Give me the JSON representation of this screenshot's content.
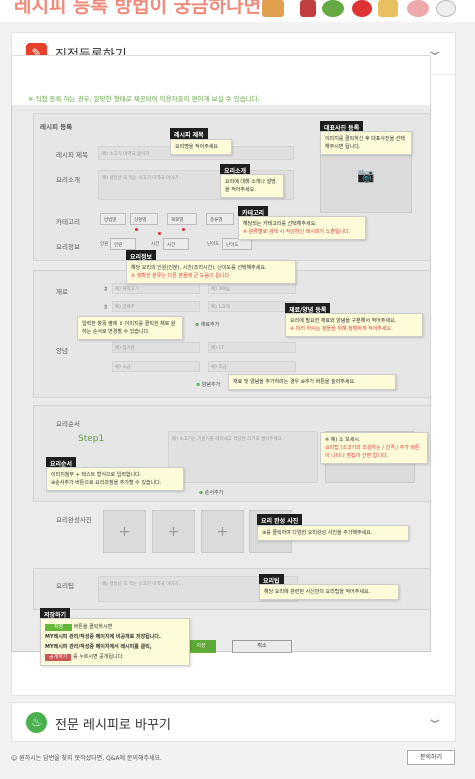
{
  "top": {
    "title": "레시피 등록 방법이 궁금하다면?"
  },
  "card": {
    "title": "직접등록하기"
  },
  "notice": "※ 직접 등록 하는 경우, 알맞한 형태로 제공되어 이용자들이 편하게 보실 수 있습니다.",
  "register": {
    "section_label": "레시피 등록",
    "title_label": "레시피 제목",
    "title_placeholder": "예) 소고기 미역국 끓이기",
    "intro_label": "요리소개",
    "intro_placeholder": "예) 생일날 꼭 먹는 소고기 미역국 이야기...",
    "category_label": "카테고리",
    "category_options": [
      "방법별",
      "상황별",
      "재료별",
      "종류별"
    ],
    "info_label": "요리정보",
    "info_items": [
      "인원",
      "인원",
      "시간",
      "시간",
      "난이도",
      "난이도"
    ],
    "photo_placeholder": "",
    "photo_label": ""
  },
  "ingredients": {
    "label": "재료",
    "rows": [
      [
        "예) 돼지고기",
        "예) 300g"
      ],
      [
        "예) 양배추",
        "예) 1/2개"
      ]
    ],
    "add": "재료추가"
  },
  "seasoning": {
    "label": "양념",
    "rows": [
      [
        "예) 참기름",
        "예) 1T"
      ],
      [
        "예) 소금",
        "예) 조금"
      ]
    ],
    "add": "양념추가"
  },
  "steps": {
    "label": "요리순서",
    "step": "Step1",
    "placeholder": "예) 소고기는 기름기를 떼어내고 적당한 크기로 썰어주세요.",
    "add": "순서추가"
  },
  "complete": {
    "label": "요리완성사진"
  },
  "tip": {
    "label": "요리팁",
    "placeholder": "예) 생일날 꼭 먹는 소고기 미역국 이야기..."
  },
  "buttons": {
    "save": "저장",
    "cancel": "취소"
  },
  "tips": {
    "title_tag": "레시피 제목",
    "title_text": "요리명을 적어주세요",
    "photo_tag": "대표사진 등록",
    "photo_text": "이미지를 클릭하신 후 대표사진을 선택해주시면 됩니다.",
    "intro_tag": "요리소개",
    "intro_text": "요리에 대해 소개나 설명을 적어주세요.",
    "category_tag": "카테고리",
    "category_text": "해당되는 카테고리를 선택해주세요.",
    "category_note": "※ 분류별로 검색 시 작성하신 레시피가 노출됩니다.",
    "info_tag": "요리정보",
    "info_text": "해당 요리의 인원(인분), 시간(조리시간), 난이도를 선택해주세요.",
    "info_note": "※ 정확한 분류는 다른 분들에 큰 도움이 됩니다.",
    "order_text": "입력한 항목 옆에 ⇕ 이미지를 클릭한 채로 원하는 순서로 변경할 수 있습니다.",
    "ing_tag": "재료/양념 등록",
    "ing_text": "요리에 필요한 재료와 양념을 구분해서 적어주세요.",
    "ing_note": "※ 미리 하시는 분들을 위해 정확하게 적어주세요.",
    "add_text": "재료 및 양념을 추가하려는 경우 ⊕추가 버튼을 눌러주세요.",
    "step_tag": "요리순서",
    "step_text": "이미지첨부 + 텍스트 형식으로 입력합니다.",
    "step_text2": "⊕순서추가 버튼으로 요리과정을 추가할 수 있습니다.",
    "step_side1": "※ 예) 소 보세시.",
    "step_side2": "요리팁 (소고기와 조성하는 / 간격 / 추가 버튼이 나타나 편집이 간편 합니다.",
    "done_tag": "요리 완성 사진",
    "done_text": "⊕를 클릭하여 다양한 요리완성 사진을 추가해주세요.",
    "tip_tag": "요리팁",
    "tip_text": "해당 요리에 관련된 사신만의 요리팁을 적어주세요.",
    "save_tag": "저장하기",
    "save_line1b": "버튼을 클릭하시면",
    "save_line2": "MY레시피 관리/작성중 페이지에 비공개로 저장됩니다.",
    "save_line3": "MY레시피 관리/작성중 페이지에서 레시피를 클릭,",
    "save_line4b": "를 누르시면 공개됩니다.",
    "save_btn1": "저장",
    "save_btn2": "공개하기"
  },
  "expert": {
    "title": "전문 레시피로 바꾸기"
  },
  "bottom": {
    "note": "원하시는 답변을 찾지 못하셨다면, Q&A에 문의해주세요.",
    "inquiry": "문의하기"
  }
}
